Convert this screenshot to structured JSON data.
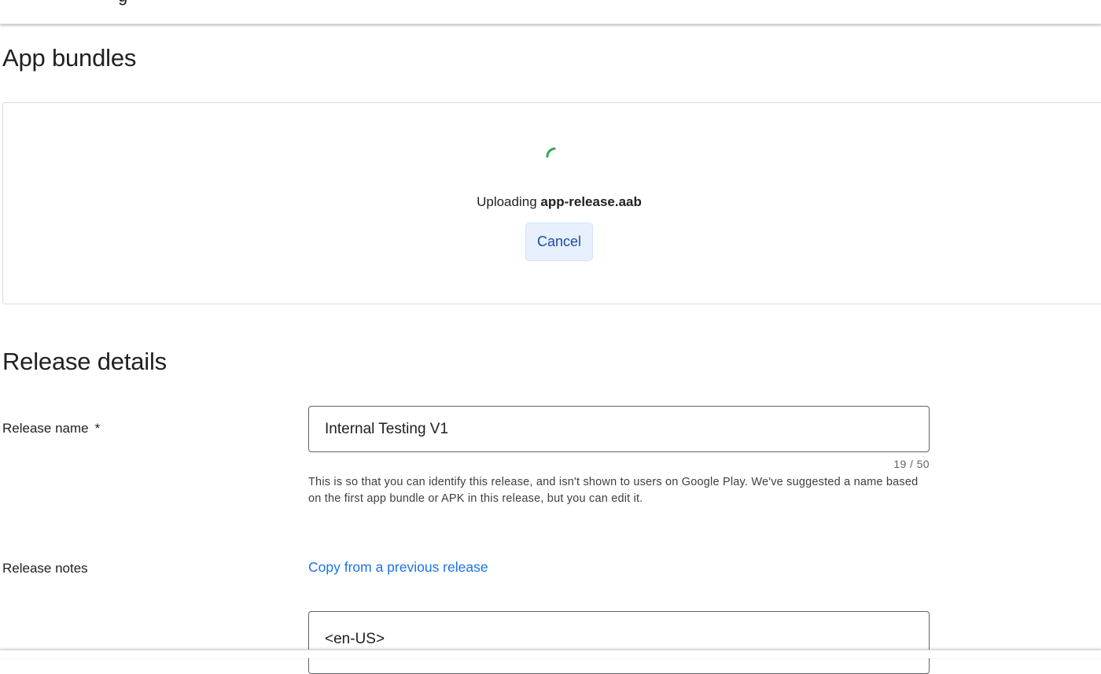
{
  "header": {
    "title_fragment": "g"
  },
  "app_bundles": {
    "title": "App bundles",
    "uploading_prefix": "Uploading ",
    "file_name": "app-release.aab",
    "cancel_label": "Cancel",
    "spinner_color": "#34a853"
  },
  "release_details": {
    "title": "Release details",
    "release_name": {
      "label": "Release name",
      "required_marker": "*",
      "value": "Internal Testing V1",
      "counter": "19 / 50",
      "helper": "This is so that you can identify this release, and isn't shown to users on Google Play. We've suggested a name based on the first app bundle or APK in this release, but you can edit it."
    },
    "release_notes": {
      "label": "Release notes",
      "copy_link": "Copy from a previous release",
      "content": "<en-US>"
    }
  },
  "colors": {
    "link": "#1a73e8",
    "button_bg": "#e8f0fe",
    "button_text": "#174ea6"
  }
}
